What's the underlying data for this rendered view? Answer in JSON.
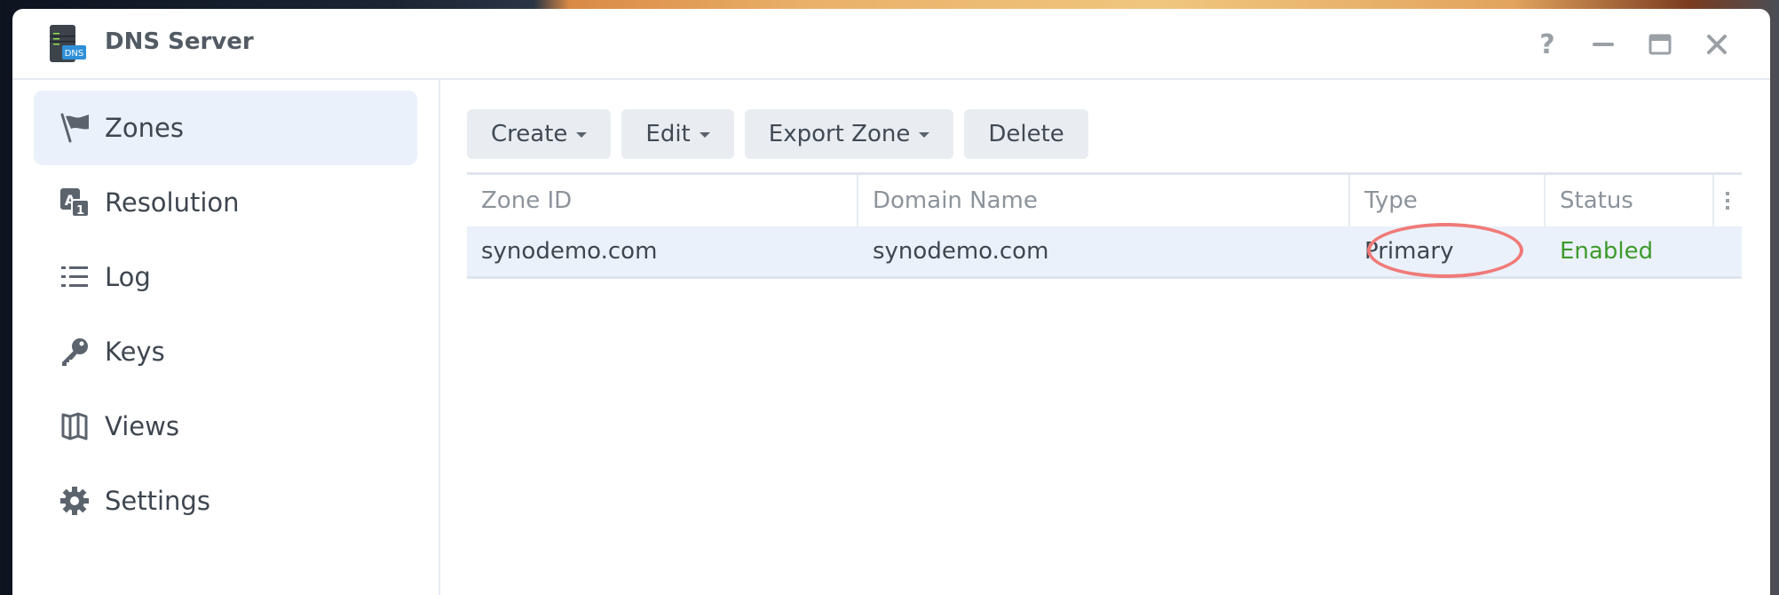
{
  "window": {
    "title": "DNS Server",
    "app_icon": "dns-server-icon",
    "app_icon_badge": "DNS",
    "controls": [
      {
        "name": "help",
        "icon": "question-icon"
      },
      {
        "name": "minimize",
        "icon": "minimize-icon"
      },
      {
        "name": "maximize",
        "icon": "maximize-icon"
      },
      {
        "name": "close",
        "icon": "close-icon"
      }
    ]
  },
  "sidebar": {
    "items": [
      {
        "label": "Zones",
        "icon": "flag-icon",
        "active": true
      },
      {
        "label": "Resolution",
        "icon": "translate-icon",
        "active": false
      },
      {
        "label": "Log",
        "icon": "list-icon",
        "active": false
      },
      {
        "label": "Keys",
        "icon": "key-icon",
        "active": false
      },
      {
        "label": "Views",
        "icon": "map-icon",
        "active": false
      },
      {
        "label": "Settings",
        "icon": "gear-icon",
        "active": false
      }
    ]
  },
  "toolbar": {
    "create_label": "Create",
    "edit_label": "Edit",
    "export_label": "Export Zone",
    "delete_label": "Delete"
  },
  "grid": {
    "columns": [
      "Zone ID",
      "Domain Name",
      "Type",
      "Status"
    ],
    "rows": [
      {
        "zone_id": "synodemo.com",
        "domain_name": "synodemo.com",
        "type": "Primary",
        "status": "Enabled"
      }
    ],
    "highlighted_cell": "Primary"
  },
  "colors": {
    "accent_selected": "#eaf1fb",
    "status_enabled": "#3e9a2b",
    "annotation": "#f07a78"
  }
}
